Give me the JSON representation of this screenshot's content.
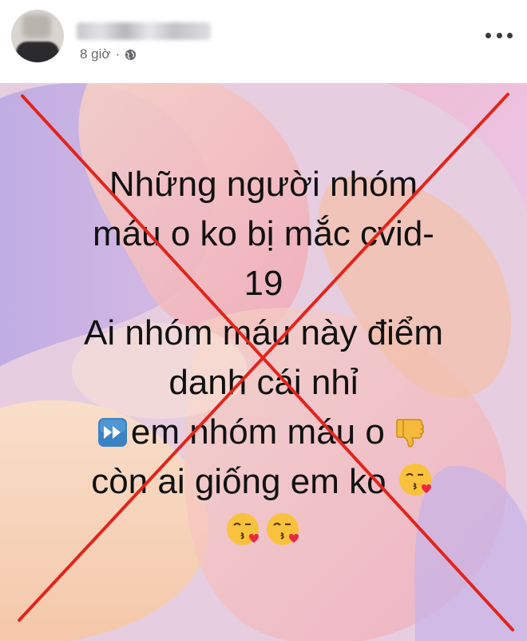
{
  "post": {
    "timestamp": "8 giờ",
    "separator": "·",
    "privacy_icon": "globe-icon",
    "more_icon": "more-options-icon",
    "lines": [
      "Những người nhóm",
      "máu o ko bị mắc cvid-",
      "19",
      "Ai nhóm máu này điểm",
      "danh cái nhỉ",
      "em nhóm máu o",
      "còn ai giống em ko"
    ],
    "emojis": {
      "fast_forward": "fast-forward-emoji",
      "thumbs_down": "thumbs-down-emoji",
      "kiss": "face-blowing-kiss-emoji"
    }
  },
  "overlay": {
    "cross_color": "#e3241b",
    "cross_icon": "red-x-cross"
  }
}
